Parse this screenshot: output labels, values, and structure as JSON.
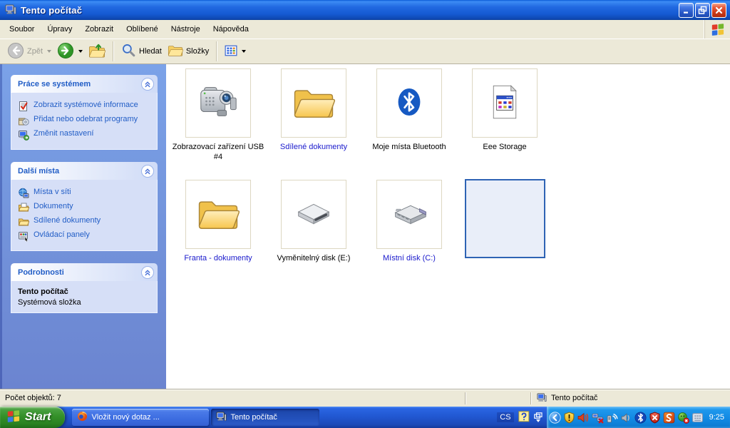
{
  "window": {
    "title": "Tento počítač"
  },
  "menubar": {
    "items": [
      "Soubor",
      "Úpravy",
      "Zobrazit",
      "Oblíbené",
      "Nástroje",
      "Nápověda"
    ]
  },
  "toolbar": {
    "back": "Zpět",
    "search": "Hledat",
    "folders": "Složky"
  },
  "sidebar": {
    "sections": [
      {
        "title": "Práce se systémem",
        "items": [
          {
            "label": "Zobrazit systémové informace",
            "icon": "system-info-icon"
          },
          {
            "label": "Přidat nebo odebrat programy",
            "icon": "add-remove-programs-icon"
          },
          {
            "label": "Změnit nastavení",
            "icon": "change-settings-icon"
          }
        ]
      },
      {
        "title": "Další místa",
        "items": [
          {
            "label": "Místa v síti",
            "icon": "network-places-icon"
          },
          {
            "label": "Dokumenty",
            "icon": "documents-icon"
          },
          {
            "label": "Sdílené dokumenty",
            "icon": "shared-folder-icon"
          },
          {
            "label": "Ovládací panely",
            "icon": "control-panel-icon"
          }
        ]
      },
      {
        "title": "Podrobnosti",
        "details": {
          "name": "Tento počítač",
          "type": "Systémová složka"
        }
      }
    ]
  },
  "main": {
    "tiles": [
      {
        "label": "Zobrazovací zařízení USB #4",
        "icon": "camcorder-icon",
        "label_color": "#000000"
      },
      {
        "label": "Sdílené dokumenty",
        "icon": "folder-icon",
        "label_color": "#1919cc"
      },
      {
        "label": "Moje místa Bluetooth",
        "icon": "bluetooth-icon",
        "label_color": "#000000"
      },
      {
        "label": "Eee Storage",
        "icon": "document-app-icon",
        "label_color": "#000000"
      },
      {
        "label": "Franta - dokumenty",
        "icon": "folder-icon",
        "label_color": "#1919cc"
      },
      {
        "label": "Vyměnitelný disk (E:)",
        "icon": "removable-disk-icon",
        "label_color": "#000000"
      },
      {
        "label": "Místní disk (C:)",
        "icon": "hard-disk-icon",
        "label_color": "#1919cc"
      },
      {
        "label": "",
        "icon": "none",
        "selected": true
      }
    ]
  },
  "statusbar": {
    "objects_count": "Počet objektů: 7",
    "location": "Tento počítač"
  },
  "taskbar": {
    "start": "Start",
    "tasks": [
      {
        "label": "Vložit nový dotaz ...",
        "icon": "firefox-icon",
        "active": false
      },
      {
        "label": "Tento počítač",
        "icon": "computer-icon",
        "active": true
      }
    ],
    "language": "CS",
    "clock": "9:25",
    "tray": [
      "collapse-chevron-icon",
      "security-shield-icon",
      "volume-icon",
      "network-disconnected-icon",
      "wireless-signal-icon",
      "audio-device-icon",
      "bluetooth-tray-icon",
      "alert-shield-icon",
      "s-app-icon",
      "app-error-icon",
      "tray-window-icon"
    ]
  },
  "colors": {
    "titlebar_blue": "#1555d6",
    "selection_border": "#2e63b4",
    "link_blue": "#215dc6",
    "label_blue": "#1919cc",
    "taskbar_blue": "#2158d2",
    "tray_blue": "#1188e2",
    "start_green": "#349029",
    "pane_blue": "#7292da"
  }
}
